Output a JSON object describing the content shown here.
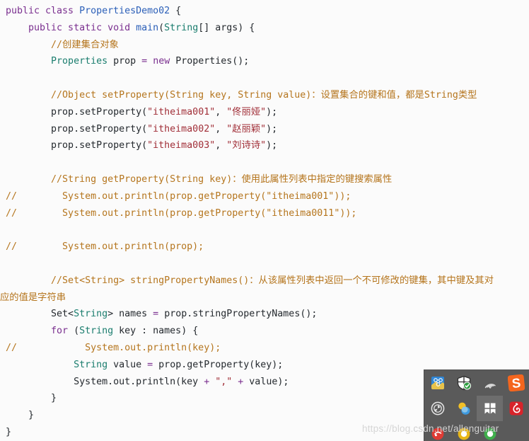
{
  "editor": {
    "background_color": "#fbfbfb",
    "font_size_px": 13,
    "lines": [
      {
        "indent": 0,
        "tokens": [
          {
            "t": "kw",
            "v": "public class "
          },
          {
            "t": "cls",
            "v": "PropertiesDemo02"
          },
          {
            "t": "txt",
            "v": " {"
          }
        ]
      },
      {
        "indent": 1,
        "tokens": [
          {
            "t": "kw",
            "v": "public static void "
          },
          {
            "t": "cls",
            "v": "main"
          },
          {
            "t": "txt",
            "v": "("
          },
          {
            "t": "typ",
            "v": "String"
          },
          {
            "t": "txt",
            "v": "[] args) {"
          }
        ]
      },
      {
        "indent": 2,
        "tokens": [
          {
            "t": "cmt",
            "v": "//创建集合对象"
          }
        ]
      },
      {
        "indent": 2,
        "tokens": [
          {
            "t": "typ",
            "v": "Properties"
          },
          {
            "t": "txt",
            "v": " prop "
          },
          {
            "t": "op",
            "v": "="
          },
          {
            "t": "txt",
            "v": " "
          },
          {
            "t": "kw",
            "v": "new"
          },
          {
            "t": "txt",
            "v": " Properties();"
          }
        ]
      },
      {
        "indent": 0,
        "tokens": []
      },
      {
        "indent": 2,
        "tokens": [
          {
            "t": "cmt",
            "v": "//Object setProperty(String key, String value)：设置集合的键和值，都是String类型"
          }
        ]
      },
      {
        "indent": 2,
        "tokens": [
          {
            "t": "txt",
            "v": "prop.setProperty("
          },
          {
            "t": "str",
            "v": "\"itheima001\""
          },
          {
            "t": "txt",
            "v": ", "
          },
          {
            "t": "str",
            "v": "\"佟丽娅\""
          },
          {
            "t": "txt",
            "v": ");"
          }
        ]
      },
      {
        "indent": 2,
        "tokens": [
          {
            "t": "txt",
            "v": "prop.setProperty("
          },
          {
            "t": "str",
            "v": "\"itheima002\""
          },
          {
            "t": "txt",
            "v": ", "
          },
          {
            "t": "str",
            "v": "\"赵丽颖\""
          },
          {
            "t": "txt",
            "v": ");"
          }
        ]
      },
      {
        "indent": 2,
        "tokens": [
          {
            "t": "txt",
            "v": "prop.setProperty("
          },
          {
            "t": "str",
            "v": "\"itheima003\""
          },
          {
            "t": "txt",
            "v": ", "
          },
          {
            "t": "str",
            "v": "\"刘诗诗\""
          },
          {
            "t": "txt",
            "v": ");"
          }
        ]
      },
      {
        "indent": 0,
        "tokens": []
      },
      {
        "indent": 2,
        "tokens": [
          {
            "t": "cmt",
            "v": "//String getProperty(String key)：使用此属性列表中指定的键搜索属性"
          }
        ]
      },
      {
        "indent": 0,
        "tokens": [
          {
            "t": "cmt",
            "v": "//        System.out.println(prop.getProperty(\"itheima001\"));"
          }
        ]
      },
      {
        "indent": 0,
        "tokens": [
          {
            "t": "cmt",
            "v": "//        System.out.println(prop.getProperty(\"itheima0011\"));"
          }
        ]
      },
      {
        "indent": 0,
        "tokens": []
      },
      {
        "indent": 0,
        "tokens": [
          {
            "t": "cmt",
            "v": "//        System.out.println(prop);"
          }
        ]
      },
      {
        "indent": 0,
        "tokens": []
      },
      {
        "indent": 2,
        "tokens": [
          {
            "t": "cmt",
            "v": "//Set<String> stringPropertyNames()：从该属性列表中返回一个不可修改的键集，其中键及其对"
          }
        ]
      },
      {
        "indent": 0,
        "wrapcont": true,
        "tokens": [
          {
            "t": "cmt",
            "v": "应的值是字符串"
          }
        ]
      },
      {
        "indent": 2,
        "tokens": [
          {
            "t": "txt",
            "v": "Set<"
          },
          {
            "t": "typ",
            "v": "String"
          },
          {
            "t": "txt",
            "v": "> names "
          },
          {
            "t": "op",
            "v": "="
          },
          {
            "t": "txt",
            "v": " prop.stringPropertyNames();"
          }
        ]
      },
      {
        "indent": 2,
        "tokens": [
          {
            "t": "kw",
            "v": "for"
          },
          {
            "t": "txt",
            "v": " ("
          },
          {
            "t": "typ",
            "v": "String"
          },
          {
            "t": "txt",
            "v": " key : names) {"
          }
        ]
      },
      {
        "indent": 0,
        "tokens": [
          {
            "t": "cmt",
            "v": "//            System.out.println(key);"
          }
        ]
      },
      {
        "indent": 3,
        "tokens": [
          {
            "t": "typ",
            "v": "String"
          },
          {
            "t": "txt",
            "v": " value "
          },
          {
            "t": "op",
            "v": "="
          },
          {
            "t": "txt",
            "v": " prop.getProperty(key);"
          }
        ]
      },
      {
        "indent": 3,
        "tokens": [
          {
            "t": "txt",
            "v": "System.out.println(key "
          },
          {
            "t": "op",
            "v": "+"
          },
          {
            "t": "txt",
            "v": " "
          },
          {
            "t": "str",
            "v": "\",\""
          },
          {
            "t": "txt",
            "v": " "
          },
          {
            "t": "op",
            "v": "+"
          },
          {
            "t": "txt",
            "v": " value);"
          }
        ]
      },
      {
        "indent": 2,
        "tokens": [
          {
            "t": "txt",
            "v": "}"
          }
        ]
      },
      {
        "indent": 1,
        "tokens": [
          {
            "t": "txt",
            "v": "}"
          }
        ]
      },
      {
        "indent": 0,
        "tokens": [
          {
            "t": "txt",
            "v": "}"
          }
        ]
      }
    ]
  },
  "tray": {
    "background_color": "#5a5a5a",
    "highlight_color": "#6d6d6d",
    "rows": [
      [
        {
          "icon": "network-connections-icon",
          "label": "Network Connections"
        },
        {
          "icon": "security-shield-icon",
          "label": "Windows Security"
        },
        {
          "icon": "wifi-icon",
          "label": "Wi-Fi"
        },
        {
          "icon": "sogou-input-icon",
          "label": "Sogou Input Method"
        }
      ],
      [
        {
          "icon": "camera-shutter-icon",
          "label": "Screen Recorder"
        },
        {
          "icon": "qq-icon",
          "label": "QQ"
        },
        {
          "icon": "windows-store-icon",
          "label": "Store",
          "highlighted": true
        },
        {
          "icon": "netease-music-icon",
          "label": "NetEase Cloud Music"
        }
      ],
      [
        {
          "icon": "red-app-icon",
          "label": "App"
        },
        {
          "icon": "yellow-app-icon",
          "label": "App"
        },
        {
          "icon": "green-app-icon",
          "label": "App"
        },
        {
          "icon": "blank-icon",
          "label": ""
        }
      ]
    ]
  },
  "watermark": {
    "prefix": "https://blog.",
    "suffix": "csdn.net/allenguitar",
    "full": "https://blog.csdn.net/allenguitar"
  }
}
